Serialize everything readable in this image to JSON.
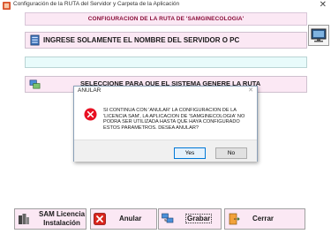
{
  "window": {
    "title": "Configuración de la RUTA del Servidor y Carpeta de la Aplicación",
    "close_glyph": "✕"
  },
  "header": {
    "title": "CONFIGURACION DE LA RUTA DE 'SAMGINECOLOGIA'"
  },
  "server_button": {
    "label": "INGRESE SOLAMENTE EL NOMBRE DEL SERVIDOR O PC",
    "icon": "server-icon"
  },
  "path_input": {
    "value": ""
  },
  "select_button": {
    "label": "SELECCIONE PARA QUE EL SISTEMA GENERE LA RUTA",
    "icon": "network-icon"
  },
  "dialog": {
    "title": "ANULAR",
    "close_glyph": "✕",
    "message": "SI CONTINUA CON 'ANULAR' LA CONFIGURACION DE LA 'LICENCIA SAM', LA APLICACION DE 'SAMGINECOLOGIA' NO PODRA SER UTILIZADA HASTA QUE HAYA CONFIGURADO ESTOS PARAMETROS.  DESEA ANULAR?",
    "yes_label": "Yes",
    "no_label": "No",
    "icon": "error-icon"
  },
  "bottom_buttons": {
    "license": {
      "label_line1": "SAM Licencia",
      "label_line2": "Instalación",
      "icon": "license-icon"
    },
    "anular": {
      "label": "Anular",
      "icon": "cancel-x-icon"
    },
    "grabar": {
      "label": "Grabar",
      "icon": "save-computers-icon"
    },
    "cerrar": {
      "label": "Cerrar",
      "icon": "exit-door-icon"
    }
  },
  "colors": {
    "button_bg": "#fbe8f4",
    "header_text": "#8a0f3a",
    "input_bg": "#e8fbfb",
    "dialog_accent": "#0078d7",
    "error_red": "#e81123"
  }
}
